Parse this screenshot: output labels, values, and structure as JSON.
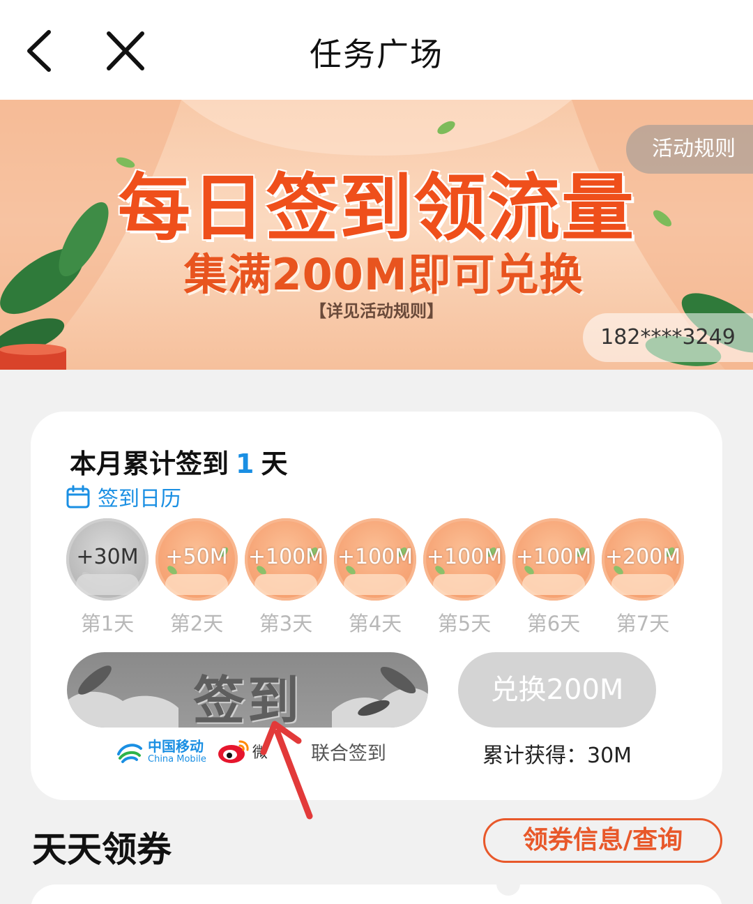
{
  "header": {
    "title": "任务广场",
    "back_icon": "chevron-left-icon",
    "close_icon": "close-icon"
  },
  "banner": {
    "headline": "每日签到领流量",
    "subline": "集满200M即可兑换",
    "note": "【详见活动规则】",
    "rules_label": "活动规则",
    "phone": "182****3249",
    "colors": {
      "headline": "#ef4f1b",
      "background": "#f8c9a8"
    }
  },
  "signin": {
    "month_prefix": "本月累计签到",
    "month_days": "1",
    "month_suffix": "天",
    "calendar_label": "签到日历",
    "days": [
      {
        "reward": "+30M",
        "label": "第1天",
        "done": true
      },
      {
        "reward": "+50M",
        "label": "第2天",
        "done": false
      },
      {
        "reward": "+100M",
        "label": "第3天",
        "done": false
      },
      {
        "reward": "+100M",
        "label": "第4天",
        "done": false
      },
      {
        "reward": "+100M",
        "label": "第5天",
        "done": false
      },
      {
        "reward": "+100M",
        "label": "第6天",
        "done": false
      },
      {
        "reward": "+200M",
        "label": "第7天",
        "done": false
      }
    ],
    "signin_button": "签到",
    "exchange_button": "兑换200M",
    "partners": {
      "china_mobile_cn": "中国移动",
      "china_mobile_en": "China Mobile",
      "weibo": "微",
      "joint_label": "联合签到"
    },
    "total_label": "累计获得：30M",
    "accent_color": "#1a8fe3"
  },
  "coupons": {
    "title": "天天领券",
    "query_button": "领券信息/查询",
    "accent_color": "#e8582a"
  }
}
